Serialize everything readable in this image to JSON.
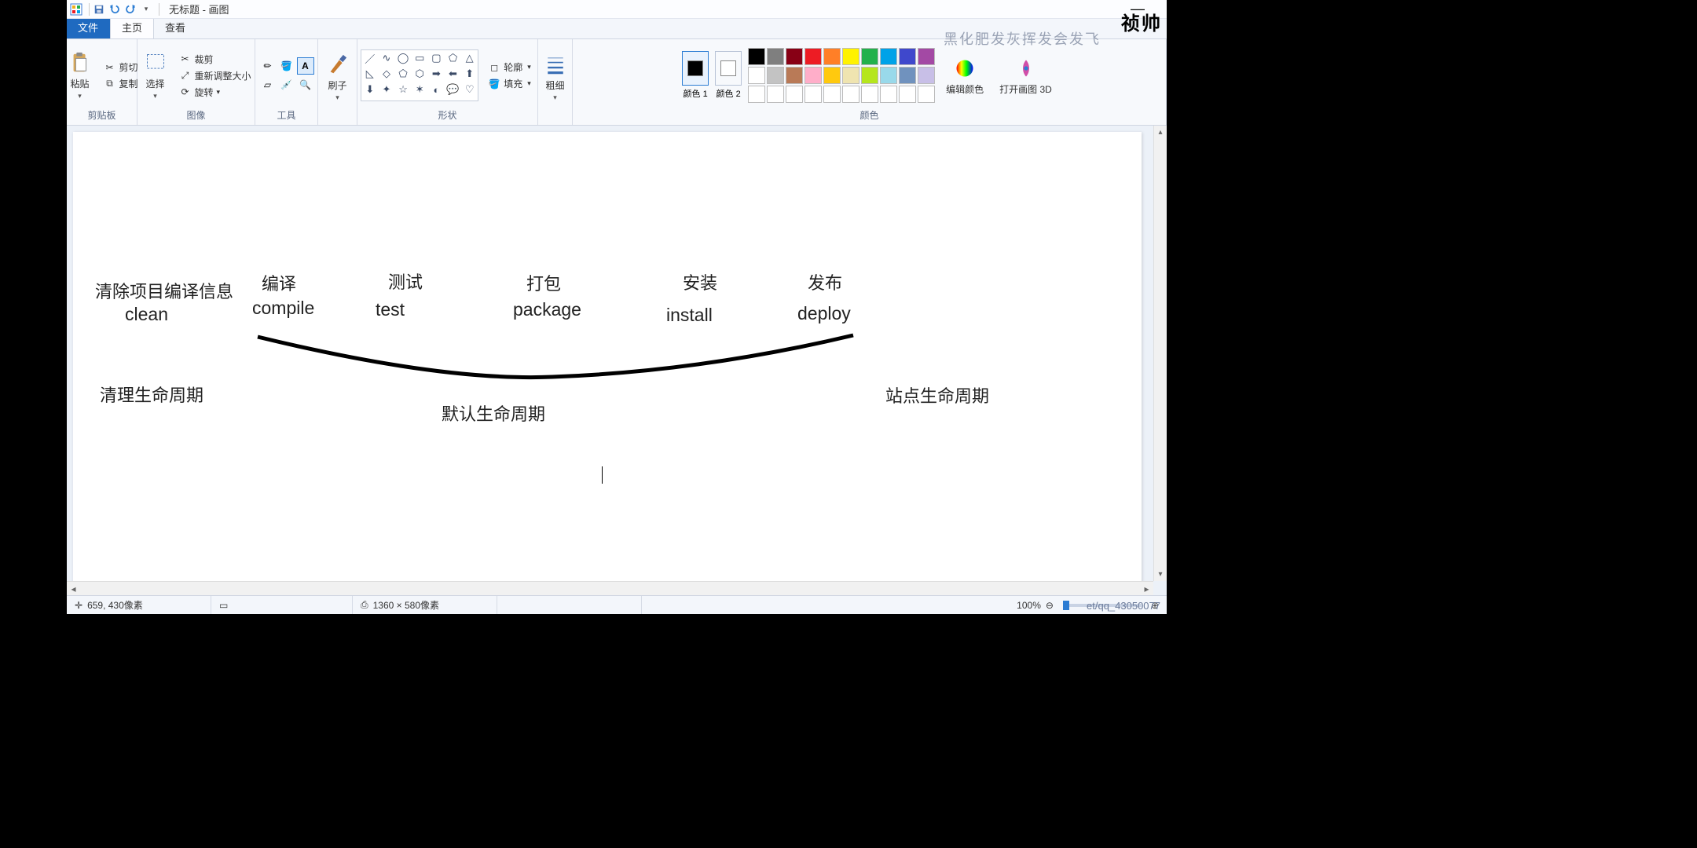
{
  "title": "无标题 - 画图",
  "tabs": {
    "file": "文件",
    "home": "主页",
    "view": "查看"
  },
  "clipboard": {
    "paste": "粘贴",
    "cut": "剪切",
    "copy": "复制",
    "group": "剪贴板"
  },
  "image": {
    "select": "选择",
    "crop": "裁剪",
    "resize": "重新调整大小",
    "rotate": "旋转",
    "group": "图像"
  },
  "tools": {
    "brush": "刷子",
    "group": "工具"
  },
  "shapes": {
    "outline": "轮廓",
    "fill": "填充",
    "group": "形状"
  },
  "size": {
    "label": "粗细"
  },
  "colors": {
    "color1": "颜色 1",
    "color2": "颜色 2",
    "edit": "编辑颜色",
    "group": "颜色"
  },
  "paint3d": {
    "label": "打开画图 3D"
  },
  "palette_row1": [
    "#000000",
    "#7f7f7f",
    "#880015",
    "#ed1c24",
    "#ff7f27",
    "#fff200",
    "#22b14c",
    "#00a2e8",
    "#3f48cc",
    "#a349a4"
  ],
  "palette_row2": [
    "#ffffff",
    "#c3c3c3",
    "#b97a57",
    "#ffaec9",
    "#ffc90e",
    "#efe4b0",
    "#b5e61d",
    "#99d9ea",
    "#7092be",
    "#c8bfe7"
  ],
  "palette_row3": [
    "#ffffff",
    "#ffffff",
    "#ffffff",
    "#ffffff",
    "#ffffff",
    "#ffffff",
    "#ffffff",
    "#ffffff",
    "#ffffff",
    "#ffffff"
  ],
  "canvas": {
    "clear_info_cn": "清除项目编译信息",
    "clean": "clean",
    "compile_cn": "编译",
    "compile": "compile",
    "test_cn": "测试",
    "test": "test",
    "package_cn": "打包",
    "package": "package",
    "install_cn": "安装",
    "install": "install",
    "deploy_cn": "发布",
    "deploy": "deploy",
    "clean_lifecycle": "清理生命周期",
    "default_lifecycle": "默认生命周期",
    "site_lifecycle": "站点生命周期"
  },
  "status": {
    "pos": "659, 430像素",
    "size": "1360 × 580像素",
    "zoom": "100%"
  },
  "watermark": {
    "text": "黑化肥发灰挥发会发飞",
    "logo": "祯帅",
    "url": "et/qq_43050077"
  }
}
